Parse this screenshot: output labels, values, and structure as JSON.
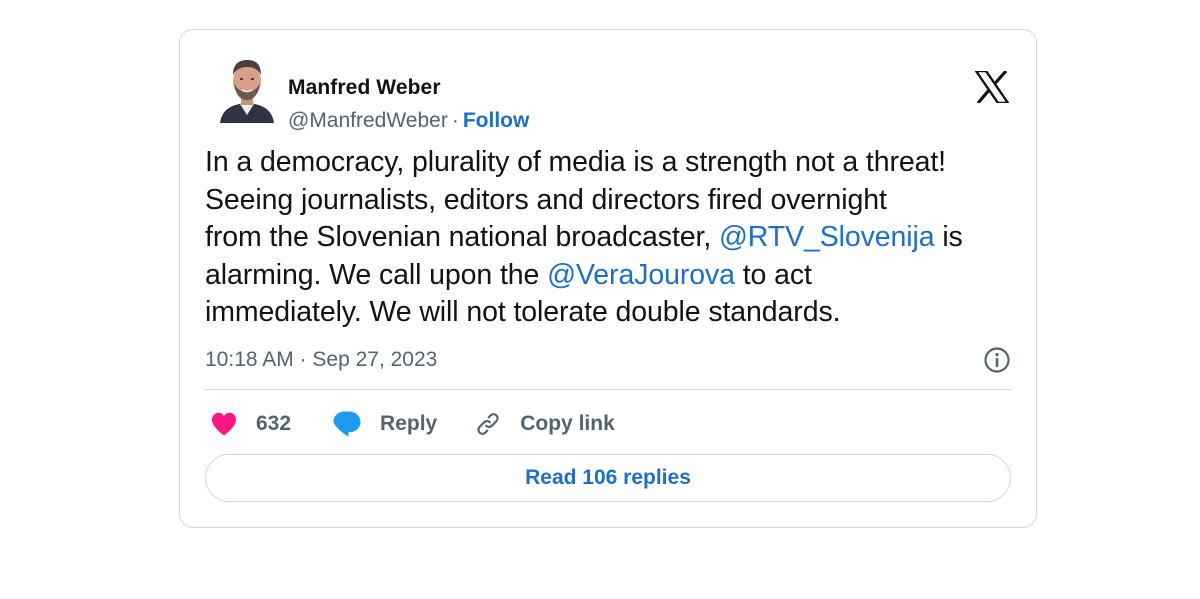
{
  "author": {
    "display_name": "Manfred Weber",
    "handle": "@ManfredWeber",
    "separator": "·",
    "follow_label": "Follow"
  },
  "tweet": {
    "lines": [
      {
        "before": "In a democracy, plurality of media is a strength not a threat!"
      },
      {
        "before": "Seeing journalists, editors and directors fired overnight"
      },
      {
        "before": "from the Slovenian national broadcaster, ",
        "mention": "@RTV_Slovenija",
        "after": " is"
      },
      {
        "before": "alarming. We call upon the ",
        "mention": "@VeraJourova",
        "after": " to act"
      },
      {
        "before": "immediately. We will not tolerate double standards."
      }
    ],
    "timestamp": "10:18 AM · Sep 27, 2023"
  },
  "actions": {
    "likes_count": "632",
    "reply_label": "Reply",
    "copy_link_label": "Copy link"
  },
  "read_replies_label": "Read 106 replies",
  "icons": {
    "logo": "x-logo-icon",
    "info": "info-icon",
    "like": "heart-icon",
    "reply": "speech-bubble-icon",
    "copy_link": "link-icon"
  },
  "colors": {
    "accent_blue": "#1d6fc8",
    "heart_pink": "#f91880",
    "reply_blue": "#1d9bf0",
    "muted_text": "#536471",
    "border": "#cfd9de"
  }
}
